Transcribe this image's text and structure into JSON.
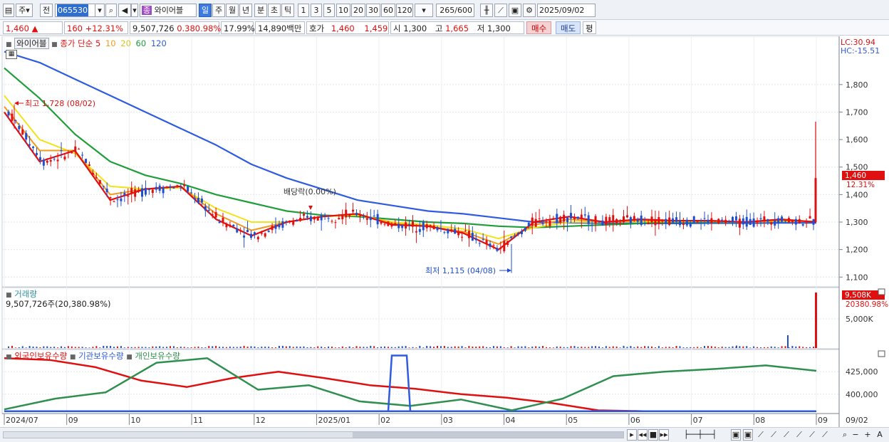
{
  "toolbar": {
    "period_code": "주",
    "prev_label": "전",
    "stock_code": "065530",
    "stock_name": "와이어블",
    "stock_badge": "종",
    "periods": [
      "일",
      "주",
      "월",
      "년",
      "분",
      "초",
      "틱"
    ],
    "selected_period": "일",
    "intervals": [
      "1",
      "3",
      "5",
      "10",
      "20",
      "30",
      "60",
      "120"
    ],
    "count_value": "265",
    "count_total": "/600",
    "date_value": "2025/09/02"
  },
  "quote": {
    "price": "1,460",
    "change": "160",
    "change_rate": "+12.31%",
    "volume": "9,507,726",
    "volume_ratio": "0.380.98%",
    "turnover": "17.99%",
    "amount": "14,890백만",
    "ask_label": "호가",
    "ask_sell": "1,460",
    "ask_buy": "1,459",
    "open_label": "시",
    "open": "1,300",
    "high_label": "고",
    "high": "1,665",
    "low_label": "저",
    "low": "1,300",
    "buy_button": "매수",
    "sell_button": "매도",
    "eval_button": "평"
  },
  "price_pane": {
    "name_box": "와이어블",
    "ma_label": "종가 단순",
    "ma_periods": [
      "5",
      "10",
      "20",
      "60",
      "120"
    ],
    "lc_label": "LC:30.94",
    "hc_label": "HC:-15.51",
    "last_price_tag": "1,460",
    "last_change_tag": "12.31%",
    "high_annotation": "최고 1,728 (08/02)",
    "low_annotation": "최저 1,115 (04/08)",
    "dividend_annotation": "배당락(0.00%)"
  },
  "volume_pane": {
    "title": "거래량",
    "value_text": "9,507,726주(20,380.98%)",
    "tag_value": "9,508K",
    "tag_ratio": "20380.98%"
  },
  "holdings_pane": {
    "series_labels": [
      "외국인보유수량",
      "기관보유수량",
      "개인보유수량"
    ]
  },
  "colors": {
    "up": "#e01010",
    "down": "#1f4fd0",
    "ma5": "#e01010",
    "ma10": "#f29b1a",
    "ma20": "#f2e21a",
    "ma60": "#1f9e3a",
    "ma120": "#2f5be0",
    "foreign": "#e01010",
    "institution": "#2f5be0",
    "individual": "#2f8f4e"
  },
  "chart_data": [
    {
      "type": "line",
      "title": "",
      "xlabel": "",
      "ylabel": "",
      "x": [
        "2024/07",
        "09",
        "10",
        "11",
        "12",
        "2025/01",
        "02",
        "03",
        "04",
        "05",
        "06",
        "07",
        "08",
        "09"
      ],
      "ylim": [
        1080,
        1960
      ],
      "yticks": [
        1100,
        1200,
        1300,
        1400,
        1500,
        1600,
        1700,
        1800
      ],
      "series": [
        {
          "name": "5",
          "values": [
            1700,
            1520,
            1560,
            1380,
            1420,
            1430,
            1310,
            1250,
            1300,
            1320,
            1330,
            1290,
            1285,
            1260,
            1200,
            1300,
            1320,
            1300,
            1310,
            1305,
            1305,
            1300,
            1310,
            1300
          ]
        },
        {
          "name": "10",
          "values": [
            1720,
            1560,
            1560,
            1400,
            1420,
            1430,
            1330,
            1270,
            1300,
            1320,
            1330,
            1295,
            1285,
            1265,
            1220,
            1290,
            1310,
            1300,
            1305,
            1305,
            1305,
            1300,
            1305,
            1302
          ]
        },
        {
          "name": "20",
          "values": [
            1760,
            1600,
            1550,
            1430,
            1420,
            1425,
            1350,
            1300,
            1300,
            1320,
            1325,
            1300,
            1290,
            1275,
            1240,
            1280,
            1300,
            1300,
            1302,
            1302,
            1303,
            1300,
            1303,
            1302
          ]
        },
        {
          "name": "60",
          "values": [
            1860,
            1750,
            1620,
            1520,
            1470,
            1440,
            1400,
            1370,
            1340,
            1325,
            1320,
            1310,
            1300,
            1295,
            1285,
            1280,
            1285,
            1290,
            1295,
            1300,
            1300,
            1300,
            1302,
            1302
          ]
        },
        {
          "name": "120",
          "values": [
            1920,
            1880,
            1820,
            1760,
            1700,
            1640,
            1580,
            1510,
            1460,
            1420,
            1380,
            1360,
            1340,
            1330,
            1315,
            1300,
            1298,
            1296,
            1295,
            1295,
            1296,
            1296,
            1297,
            1297
          ]
        }
      ],
      "annotations": [
        "최고 1,728 (08/02)",
        "최저 1,115 (04/08)",
        "배당락(0.00%)"
      ]
    },
    {
      "type": "bar",
      "title": "거래량",
      "ylim": [
        0,
        10000
      ],
      "yticks": [
        5000
      ],
      "last_value_k": 9508
    },
    {
      "type": "line",
      "title": "",
      "ylim": [
        380000,
        445000
      ],
      "yticks": [
        400000,
        425000
      ],
      "series": [
        {
          "name": "외국인보유수량",
          "values": [
            440000,
            438000,
            430000,
            415000,
            408000,
            418000,
            425000,
            418000,
            410000,
            406000,
            400000,
            396000,
            390000,
            382000,
            381000,
            381000,
            381000
          ]
        },
        {
          "name": "기관보유수량",
          "values": [
            381000,
            381000,
            381000,
            381000,
            381000,
            381000,
            381000,
            381000,
            381000,
            381000,
            381000,
            381000,
            381000,
            381000,
            381000,
            381000,
            381000
          ]
        },
        {
          "name": "개인보유수량",
          "values": [
            383000,
            395000,
            402000,
            435000,
            440000,
            405000,
            410000,
            392000,
            387000,
            394000,
            382000,
            395000,
            420000,
            425000,
            428000,
            432000,
            426000
          ]
        }
      ]
    }
  ]
}
